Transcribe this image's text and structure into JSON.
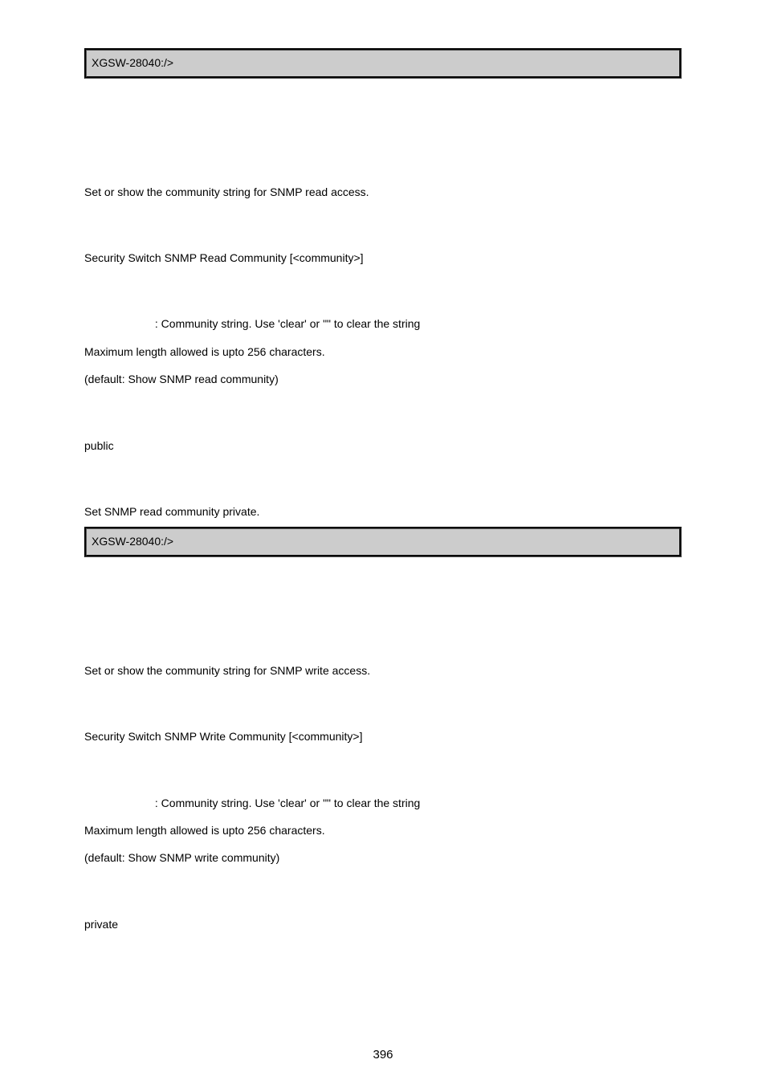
{
  "box1": "XGSW-28040:/>",
  "read": {
    "description": "Set or show the community string for SNMP read access.",
    "syntax": "Security Switch SNMP Read Community [<community>]",
    "param_desc": ": Community string. Use 'clear' or \"\" to clear the string",
    "max_len": "Maximum length allowed is upto 256 characters.",
    "default": "(default: Show SNMP read community)",
    "default_setting": "public",
    "example": "Set SNMP read community private."
  },
  "box2": "XGSW-28040:/>",
  "write": {
    "description": "Set or show the community string for SNMP write access.",
    "syntax": "Security Switch SNMP Write Community [<community>]",
    "param_desc": ": Community string. Use 'clear' or \"\" to clear the string",
    "max_len": "Maximum length allowed is upto 256 characters.",
    "default": "(default: Show SNMP write community)",
    "default_setting": "private"
  },
  "page_number": "396"
}
